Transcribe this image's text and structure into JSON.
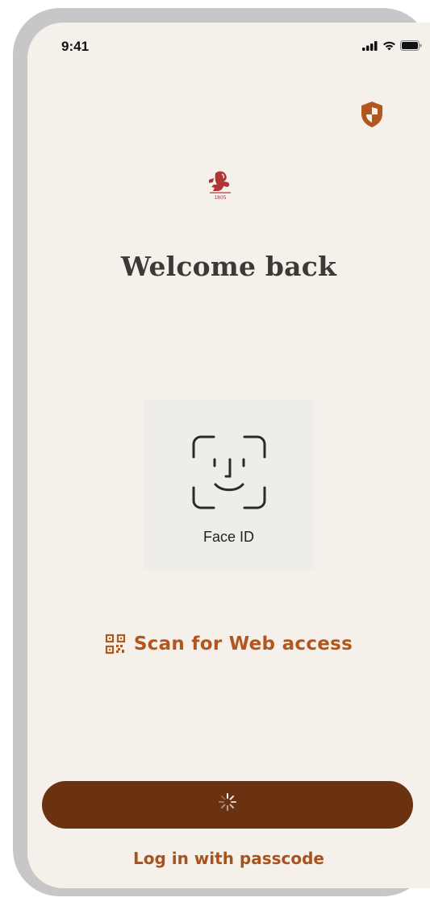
{
  "status_bar": {
    "time": "9:41",
    "icons": [
      "signal-icon",
      "wifi-icon",
      "battery-icon"
    ]
  },
  "header": {
    "security_icon": "shield-icon",
    "logo_icon": "lion-crest-logo",
    "logo_year": "1805"
  },
  "main": {
    "title": "Welcome back",
    "face_id": {
      "icon": "face-id-icon",
      "label": "Face ID"
    },
    "scan": {
      "icon": "qr-code-icon",
      "label": "Scan for Web access"
    }
  },
  "footer": {
    "primary_button_state": "loading",
    "spinner_icon": "spinner-icon",
    "passcode_link": "Log in with passcode"
  },
  "colors": {
    "background": "#f5f1ea",
    "accent": "#b2561f",
    "button": "#6a3211",
    "logo": "#b23535"
  }
}
